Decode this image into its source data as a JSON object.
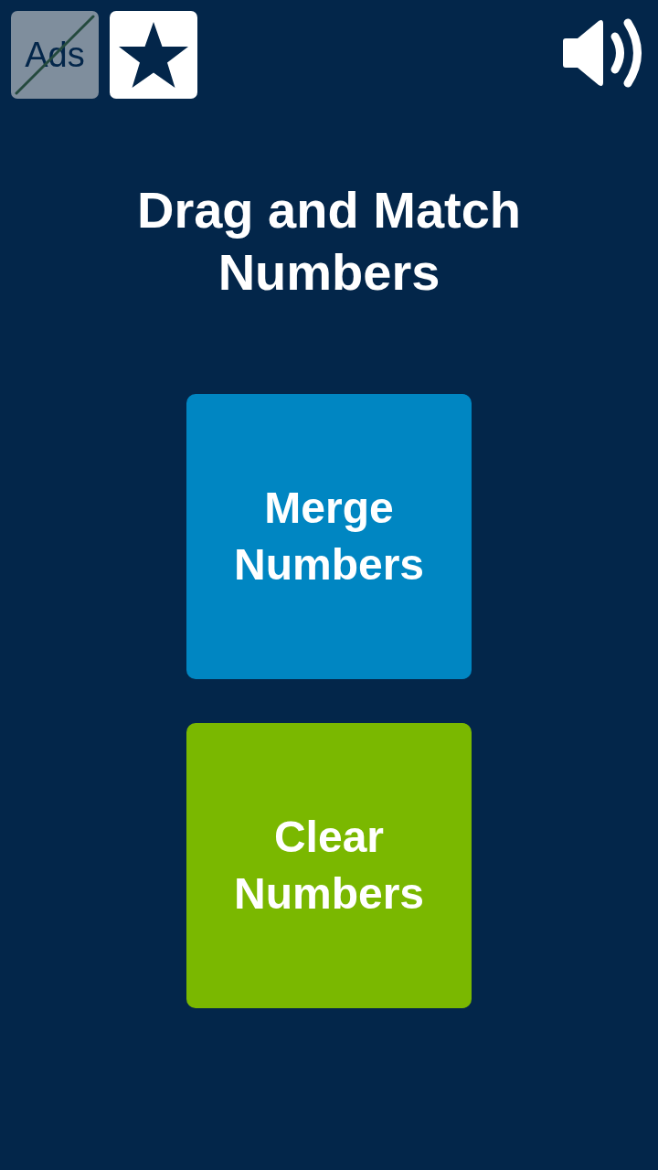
{
  "top_bar": {
    "ads_button": {
      "label": "Ads",
      "crossed_out": true
    },
    "sound": {
      "on": true
    }
  },
  "title": "Drag and Match Numbers",
  "modes": [
    {
      "label": "Merge Numbers",
      "kind": "merge"
    },
    {
      "label": "Clear Numbers",
      "kind": "clear"
    }
  ]
}
